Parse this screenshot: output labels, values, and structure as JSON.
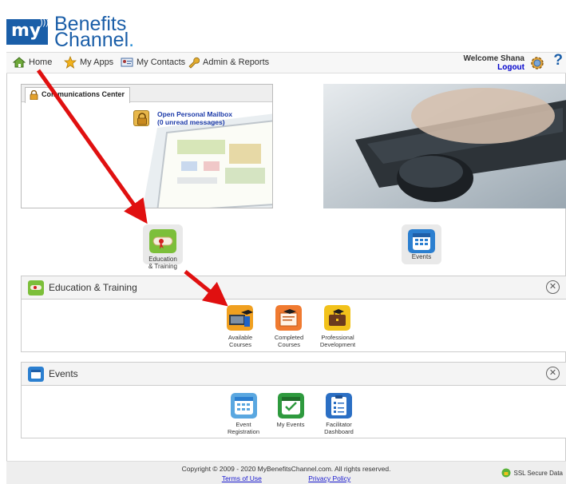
{
  "brand": {
    "my": "my",
    "line1": "Benefits",
    "line2": "Channel"
  },
  "nav": {
    "items": [
      {
        "label": "Home",
        "icon": "home-icon"
      },
      {
        "label": "My Apps",
        "icon": "star-icon"
      },
      {
        "label": "My Contacts",
        "icon": "contact-card-icon"
      },
      {
        "label": "Admin & Reports",
        "icon": "wrench-icon"
      }
    ],
    "welcome": "Welcome Shana",
    "logout": "Logout"
  },
  "comm_center": {
    "tab_label": "Communications Center",
    "mailbox_line1": "Open Personal Mailbox",
    "mailbox_line2": "(0 unread messages)"
  },
  "app_tiles": {
    "education": {
      "line1": "Education",
      "line2": "& Training"
    },
    "events": {
      "label": "Events"
    }
  },
  "education_panel": {
    "title": "Education & Training",
    "items": [
      {
        "line1": "Available",
        "line2": "Courses"
      },
      {
        "line1": "Completed",
        "line2": "Courses"
      },
      {
        "line1": "Professional",
        "line2": "Development"
      }
    ]
  },
  "events_panel": {
    "title": "Events",
    "items": [
      {
        "line1": "Event",
        "line2": "Registration"
      },
      {
        "line1": "My Events",
        "line2": ""
      },
      {
        "line1": "Facilitator",
        "line2": "Dashboard"
      }
    ]
  },
  "footer": {
    "copyright": "Copyright © 2009 - 2020 MyBenefitsChannel.com. All rights reserved.",
    "terms": "Terms of Use",
    "privacy": "Privacy Policy",
    "ssl": "SSL Secure Data"
  },
  "colors": {
    "brand_blue": "#1a5ea8",
    "arrow_red": "#e01010",
    "edu_green": "#7cbf3a",
    "events_blue": "#2b7fd0",
    "my_events_green": "#2e9a3e",
    "course_orange": "#f0a020"
  }
}
